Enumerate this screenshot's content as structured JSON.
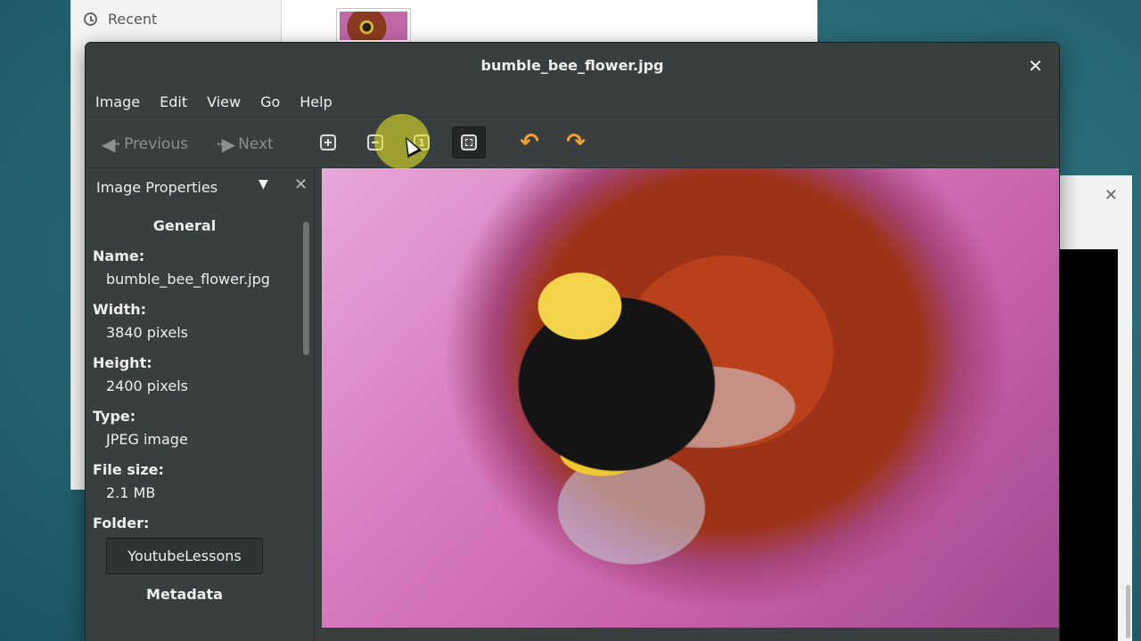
{
  "file_manager": {
    "sidebar_recent": "Recent"
  },
  "viewer": {
    "title": "bumble_bee_flower.jpg",
    "menu": [
      "Image",
      "Edit",
      "View",
      "Go",
      "Help"
    ],
    "toolbar": {
      "previous_label": "Previous",
      "next_label": "Next",
      "zoom_normal_glyph": "1"
    },
    "sidebar": {
      "title": "Image Properties",
      "section_general": "General",
      "properties": {
        "name_label": "Name:",
        "name_value": "bumble_bee_flower.jpg",
        "width_label": "Width:",
        "width_value": "3840 pixels",
        "height_label": "Height:",
        "height_value": "2400 pixels",
        "type_label": "Type:",
        "type_value": "JPEG image",
        "size_label": "File size:",
        "size_value": "2.1 MB",
        "folder_label": "Folder:",
        "folder_value": "YoutubeLessons"
      },
      "section_metadata": "Metadata"
    }
  }
}
